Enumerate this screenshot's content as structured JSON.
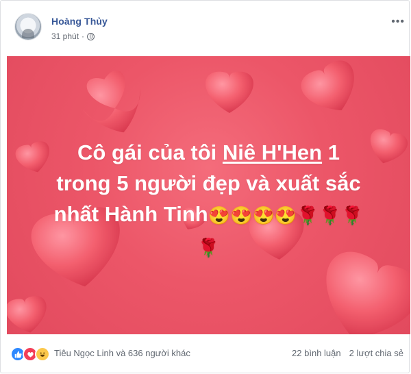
{
  "author": {
    "name": "Hoàng Thủy",
    "time": "31 phút"
  },
  "header": {
    "more_label": "•••"
  },
  "post": {
    "line1_prefix": "Cô gái của tôi ",
    "line1_name": "Niê H'Hen",
    "line1_suffix": " 1",
    "line2": "trong 5 người đẹp và xuất sắc",
    "line3": "nhất Hành Tinh",
    "emojis_line3": "😍😍😍😍🌹🌹🌹",
    "emojis_line4": "🌹",
    "background_color": "#ec5668"
  },
  "footer": {
    "reactions_text": "Tiêu Ngọc Linh và 636 người khác",
    "comments": "22 bình luận",
    "shares": "2 lượt chia sẻ",
    "reaction_icons": [
      "like-icon",
      "love-icon",
      "haha-icon"
    ]
  }
}
